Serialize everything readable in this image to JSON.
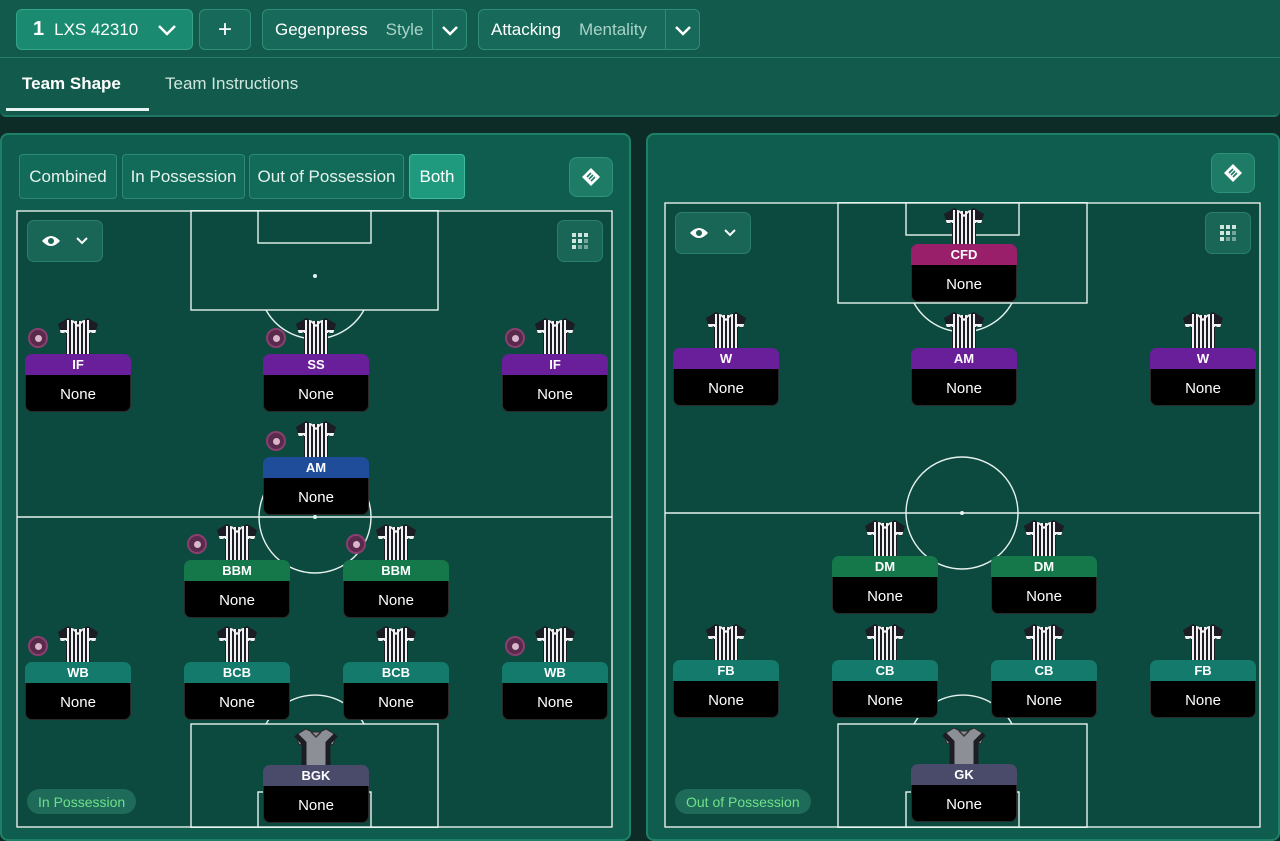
{
  "header": {
    "tactic_slot": "1",
    "tactic_name": "LXS 42310",
    "add_label": "+",
    "style_value": "Gegenpress",
    "style_label": "Style",
    "mentality_value": "Attacking",
    "mentality_label": "Mentality"
  },
  "tabs": [
    {
      "label": "Team Shape",
      "active": true
    },
    {
      "label": "Team Instructions",
      "active": false
    }
  ],
  "left_panel": {
    "segments": [
      {
        "label": "Combined",
        "active": false
      },
      {
        "label": "In Possession",
        "active": false
      },
      {
        "label": "Out of Possession",
        "active": false
      },
      {
        "label": "Both",
        "active": true
      }
    ],
    "phase_label": "In Possession",
    "players": [
      {
        "role": "IF",
        "duty": "None",
        "color": "#6a1f9a",
        "indicator": true,
        "gk": false
      },
      {
        "role": "SS",
        "duty": "None",
        "color": "#6a1f9a",
        "indicator": true,
        "gk": false
      },
      {
        "role": "IF",
        "duty": "None",
        "color": "#6a1f9a",
        "indicator": true,
        "gk": false
      },
      {
        "role": "AM",
        "duty": "None",
        "color": "#1f4d9a",
        "indicator": true,
        "gk": false
      },
      {
        "role": "BBM",
        "duty": "None",
        "color": "#15784a",
        "indicator": true,
        "gk": false
      },
      {
        "role": "BBM",
        "duty": "None",
        "color": "#15784a",
        "indicator": true,
        "gk": false
      },
      {
        "role": "WB",
        "duty": "None",
        "color": "#137a6c",
        "indicator": true,
        "gk": false
      },
      {
        "role": "BCB",
        "duty": "None",
        "color": "#137a6c",
        "indicator": false,
        "gk": false
      },
      {
        "role": "BCB",
        "duty": "None",
        "color": "#137a6c",
        "indicator": false,
        "gk": false
      },
      {
        "role": "WB",
        "duty": "None",
        "color": "#137a6c",
        "indicator": true,
        "gk": false
      },
      {
        "role": "BGK",
        "duty": "None",
        "color": "#4a4a6a",
        "indicator": false,
        "gk": true
      }
    ]
  },
  "right_panel": {
    "phase_label": "Out of Possession",
    "players": [
      {
        "role": "CFD",
        "duty": "None",
        "color": "#9a1f6a",
        "indicator": false,
        "gk": false
      },
      {
        "role": "W",
        "duty": "None",
        "color": "#6a1f9a",
        "indicator": false,
        "gk": false
      },
      {
        "role": "AM",
        "duty": "None",
        "color": "#6a1f9a",
        "indicator": false,
        "gk": false
      },
      {
        "role": "W",
        "duty": "None",
        "color": "#6a1f9a",
        "indicator": false,
        "gk": false
      },
      {
        "role": "DM",
        "duty": "None",
        "color": "#15784a",
        "indicator": false,
        "gk": false
      },
      {
        "role": "DM",
        "duty": "None",
        "color": "#15784a",
        "indicator": false,
        "gk": false
      },
      {
        "role": "FB",
        "duty": "None",
        "color": "#137a6c",
        "indicator": false,
        "gk": false
      },
      {
        "role": "CB",
        "duty": "None",
        "color": "#137a6c",
        "indicator": false,
        "gk": false
      },
      {
        "role": "CB",
        "duty": "None",
        "color": "#137a6c",
        "indicator": false,
        "gk": false
      },
      {
        "role": "FB",
        "duty": "None",
        "color": "#137a6c",
        "indicator": false,
        "gk": false
      },
      {
        "role": "GK",
        "duty": "None",
        "color": "#4a4a6a",
        "indicator": false,
        "gk": true
      }
    ]
  },
  "icons": {
    "chevron": "chevron-down-icon",
    "eye": "eye-icon",
    "grid": "grid-view-icon",
    "tactic_board": "tactic-board-icon",
    "indicator": "player-instruction-icon"
  }
}
